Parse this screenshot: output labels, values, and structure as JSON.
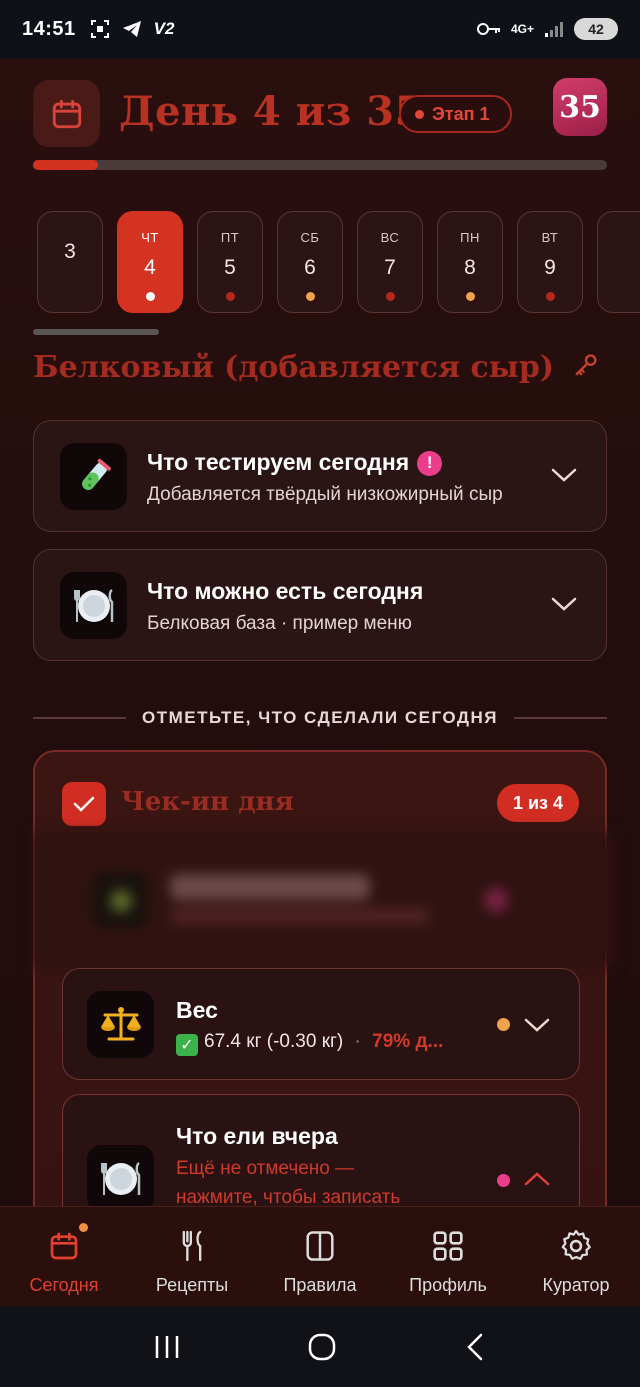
{
  "status_bar": {
    "time": "14:51",
    "app_icons": [
      "screenshot-icon",
      "telegram-icon",
      "v2-icon"
    ],
    "v2_label": "V2",
    "network": "4G+",
    "battery": "42"
  },
  "header": {
    "day_title": "День 4 из 35",
    "stage_label": "Этап 1",
    "badge_number": "35",
    "progress_fraction": 0.114
  },
  "days": [
    {
      "weekday": "",
      "number": "3",
      "dot": ""
    },
    {
      "weekday": "ЧТ",
      "number": "4",
      "dot": "#ffffff",
      "active": true
    },
    {
      "weekday": "ПТ",
      "number": "5",
      "dot": "#b5281d"
    },
    {
      "weekday": "СБ",
      "number": "6",
      "dot": "#f0a34a"
    },
    {
      "weekday": "ВС",
      "number": "7",
      "dot": "#b5281d"
    },
    {
      "weekday": "ПН",
      "number": "8",
      "dot": "#f0a34a"
    },
    {
      "weekday": "ВТ",
      "number": "9",
      "dot": "#b5281d"
    }
  ],
  "section": {
    "title": "Белковый (добавляется сыр)"
  },
  "cards": {
    "test": {
      "title": "Что тестируем сегодня",
      "badge": "!",
      "subtitle": "Добавляется твёрдый низкожирный сыр"
    },
    "eat": {
      "title": "Что можно есть сегодня",
      "subtitle": "Белковая база · пример меню"
    }
  },
  "divider_label": "ОТМЕТЬТЕ, ЧТО СДЕЛАЛИ СЕГОДНЯ",
  "checkin": {
    "title": "Чек-ин дня",
    "count": "1 из 4",
    "weight": {
      "title": "Вес",
      "value": "67.4 кг (-0.30 кг)",
      "separator": "·",
      "percent": "79% д..."
    },
    "yesterday": {
      "title": "Что ели вчера",
      "hint_line1": "Ещё не отмечено —",
      "hint_line2": "нажмите, чтобы записать"
    }
  },
  "bottom_nav": [
    {
      "label": "Сегодня",
      "icon": "calendar-icon",
      "active": true
    },
    {
      "label": "Рецепты",
      "icon": "cutlery-icon"
    },
    {
      "label": "Правила",
      "icon": "book-icon"
    },
    {
      "label": "Профиль",
      "icon": "grid-icon"
    },
    {
      "label": "Куратор",
      "icon": "gear-icon"
    }
  ],
  "colors": {
    "accent": "#d53322",
    "background": "#240d0d",
    "pink": "#ea3e8c",
    "orange": "#f0a34a"
  }
}
